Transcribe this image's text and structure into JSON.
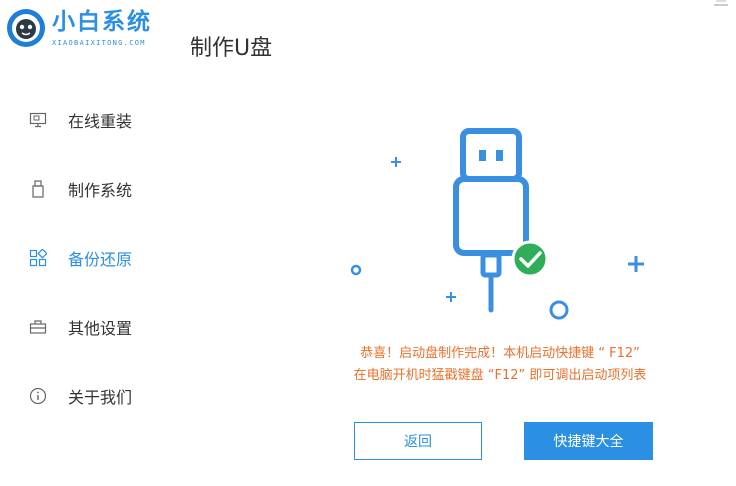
{
  "app": {
    "brand_name": "小白系统",
    "brand_sub": "XIAOBAIXITONG.COM",
    "page_title": "制作U盘",
    "accent_color": "#2b8fe3",
    "message_color": "#e8712b",
    "success_color": "#27ae60"
  },
  "sidebar": {
    "items": [
      {
        "label": "在线重装",
        "icon": "monitor-icon",
        "active": false
      },
      {
        "label": "制作系统",
        "icon": "usb-drive-icon",
        "active": false
      },
      {
        "label": "备份还原",
        "icon": "grid-apps-icon",
        "active": true
      },
      {
        "label": "其他设置",
        "icon": "toolbox-icon",
        "active": false
      },
      {
        "label": "关于我们",
        "icon": "info-icon",
        "active": false
      }
    ]
  },
  "main": {
    "illustration": "usb-cable-success-icon",
    "message_line1": "恭喜！启动盘制作完成！本机启动快捷键 “ F12”",
    "message_line2": "在电脑开机时猛戳键盘 “F12” 即可调出启动项列表",
    "back_button": "返回",
    "hotkeys_button": "快捷键大全"
  }
}
